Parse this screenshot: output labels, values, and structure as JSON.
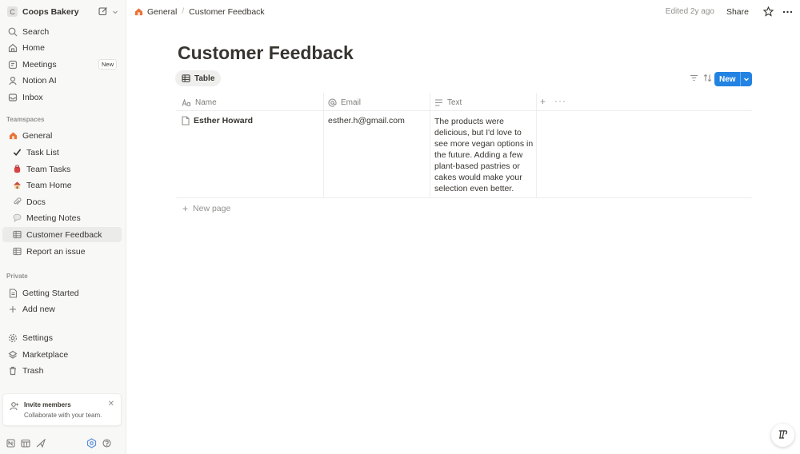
{
  "workspace": {
    "avatar_letter": "C",
    "name": "Coops Bakery"
  },
  "sidebar": {
    "top_items": [
      {
        "label": "Search",
        "icon": "search-icon"
      },
      {
        "label": "Home",
        "icon": "home-icon"
      },
      {
        "label": "Meetings",
        "icon": "meetings-icon",
        "badge": "New"
      },
      {
        "label": "Notion AI",
        "icon": "notion-ai-icon"
      },
      {
        "label": "Inbox",
        "icon": "inbox-icon"
      }
    ],
    "teamspaces_label": "Teamspaces",
    "teamspace": {
      "label": "General",
      "icon": "house-emoji-icon"
    },
    "team_items": [
      {
        "label": "Task List",
        "icon": "checkmark-emoji-icon"
      },
      {
        "label": "Team Tasks",
        "icon": "backpack-emoji-icon"
      },
      {
        "label": "Team Home",
        "icon": "house-emoji-icon"
      },
      {
        "label": "Docs",
        "icon": "paperclip-emoji-icon"
      },
      {
        "label": "Meeting Notes",
        "icon": "speech-bubble-emoji-icon"
      },
      {
        "label": "Customer Feedback",
        "icon": "table-icon",
        "active": true
      },
      {
        "label": "Report an issue",
        "icon": "table-icon"
      }
    ],
    "private_label": "Private",
    "private_items": [
      {
        "label": "Getting Started",
        "icon": "page-icon"
      },
      {
        "label": "Add new",
        "icon": "plus-icon"
      }
    ],
    "bottom_items": [
      {
        "label": "Settings",
        "icon": "gear-icon"
      },
      {
        "label": "Marketplace",
        "icon": "marketplace-icon"
      },
      {
        "label": "Trash",
        "icon": "trash-icon"
      }
    ],
    "invite": {
      "title": "Invite members",
      "subtitle": "Collaborate with your team."
    }
  },
  "topbar": {
    "breadcrumb": [
      "General",
      "Customer Feedback"
    ],
    "edited": "Edited 2y ago",
    "share": "Share"
  },
  "page": {
    "title": "Customer Feedback",
    "view_tab": "Table",
    "new_button": "New",
    "columns": [
      {
        "label": "Name",
        "icon": "title-property-icon"
      },
      {
        "label": "Email",
        "icon": "at-sign-icon"
      },
      {
        "label": "Text",
        "icon": "text-lines-icon"
      }
    ],
    "rows": [
      {
        "name": "Esther Howard",
        "email": "esther.h@gmail.com",
        "text": "The products were delicious, but I'd love to see more vegan options in the future. Adding a few plant-based pastries or cakes would make your selection even better."
      }
    ],
    "new_page": "New page"
  },
  "colors": {
    "accent": "#2383e2",
    "sidebar_bg": "#f8f8f7",
    "text": "#37352f"
  }
}
